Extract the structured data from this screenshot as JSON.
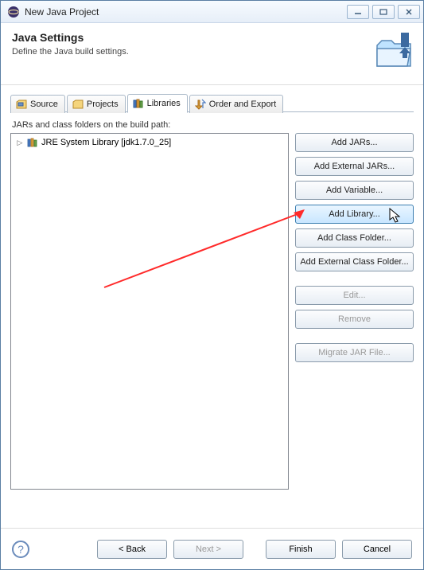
{
  "window": {
    "title": "New Java Project"
  },
  "header": {
    "title": "Java Settings",
    "subtitle": "Define the Java build settings."
  },
  "tabs": {
    "source": "Source",
    "projects": "Projects",
    "libraries": "Libraries",
    "order": "Order and Export"
  },
  "list_label": "JARs and class folders on the build path:",
  "tree": {
    "item0": "JRE System Library [jdk1.7.0_25]"
  },
  "buttons": {
    "add_jars": "Add JARs...",
    "add_ext_jars": "Add External JARs...",
    "add_variable": "Add Variable...",
    "add_library": "Add Library...",
    "add_class_folder": "Add Class Folder...",
    "add_ext_class_folder": "Add External Class Folder...",
    "edit": "Edit...",
    "remove": "Remove",
    "migrate": "Migrate JAR File..."
  },
  "footer": {
    "back": "< Back",
    "next": "Next >",
    "finish": "Finish",
    "cancel": "Cancel"
  }
}
